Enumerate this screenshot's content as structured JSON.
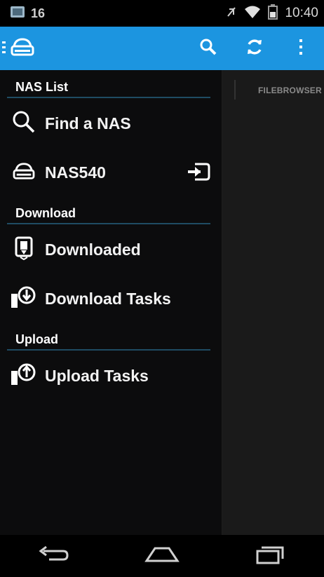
{
  "status_bar": {
    "notification_count": "16",
    "time": "10:40",
    "icons": [
      "image-notification-icon",
      "no-sound-icon",
      "wifi-icon",
      "battery-icon"
    ]
  },
  "action_bar": {
    "color": "#1c95e0",
    "app_icon": "nas-drive-icon",
    "actions": [
      "search-icon",
      "refresh-icon",
      "overflow-menu-icon"
    ]
  },
  "content": {
    "tab_label": "FILEBROWSER"
  },
  "drawer": {
    "sections": [
      {
        "title": "NAS List"
      },
      {
        "title": "Download"
      },
      {
        "title": "Upload"
      }
    ],
    "items": {
      "find_nas": "Find a NAS",
      "nas540": "NAS540",
      "downloaded": "Downloaded",
      "download_tasks": "Download Tasks",
      "upload_tasks": "Upload Tasks"
    }
  },
  "nav_bar": {
    "buttons": [
      "back-icon",
      "home-icon",
      "recent-apps-icon"
    ]
  }
}
